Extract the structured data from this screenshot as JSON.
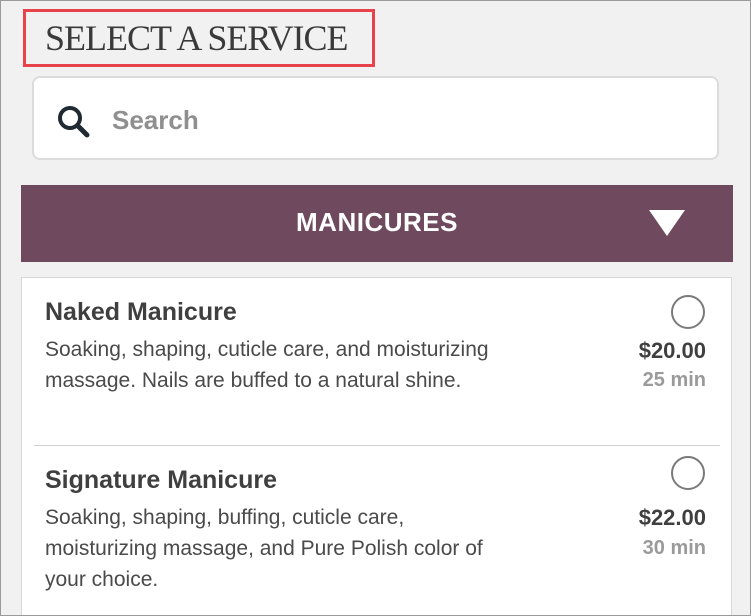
{
  "header": {
    "title": "SELECT A SERVICE"
  },
  "search": {
    "placeholder": "Search",
    "value": ""
  },
  "category": {
    "label": "MANICURES",
    "expanded": true
  },
  "services": [
    {
      "name": "Naked Manicure",
      "description": "Soaking, shaping, cuticle care, and moisturizing massage. Nails are buffed to a natural shine.",
      "price": "$20.00",
      "duration": "25 min",
      "selected": false
    },
    {
      "name": "Signature Manicure",
      "description": "Soaking, shaping, buffing, cuticle care, moisturizing massage, and Pure Polish color of your choice.",
      "price": "$22.00",
      "duration": "30 min",
      "selected": false
    }
  ],
  "colors": {
    "accent": "#6f4a5e",
    "highlight_border": "#e8434b",
    "background": "#f1f1f1"
  },
  "icons": {
    "search": "magnifier-icon",
    "dropdown": "triangle-down-icon"
  }
}
